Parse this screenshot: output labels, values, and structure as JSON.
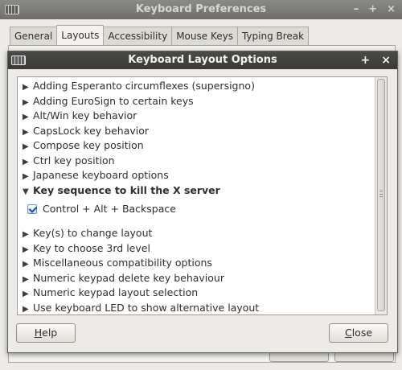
{
  "parent_window": {
    "title": "Keyboard Preferences",
    "controls": {
      "minimize": "–",
      "maximize": "+",
      "close": "×"
    },
    "tabs": [
      {
        "label": "General"
      },
      {
        "label": "Layouts",
        "active": true
      },
      {
        "label": "Accessibility"
      },
      {
        "label": "Mouse Keys"
      },
      {
        "label": "Typing Break"
      }
    ]
  },
  "dialog": {
    "title": "Keyboard Layout Options",
    "controls": {
      "maximize": "+",
      "close": "×"
    },
    "tree": {
      "rows_before": [
        {
          "label": "Adding Esperanto circumflexes (supersigno)",
          "arrow": "▶"
        },
        {
          "label": "Adding EuroSign to certain keys",
          "arrow": "▶"
        },
        {
          "label": "Alt/Win key behavior",
          "arrow": "▶"
        },
        {
          "label": "CapsLock key behavior",
          "arrow": "▶"
        },
        {
          "label": "Compose key position",
          "arrow": "▶"
        },
        {
          "label": "Ctrl key position",
          "arrow": "▶"
        },
        {
          "label": "Japanese keyboard options",
          "arrow": "▶"
        }
      ],
      "expanded_row": {
        "label": "Key sequence to kill the X server",
        "arrow": "▼"
      },
      "child_option": {
        "label": "Control + Alt + Backspace",
        "checked": true
      },
      "rows_after": [
        {
          "label": "Key(s) to change layout",
          "arrow": "▶"
        },
        {
          "label": "Key to choose 3rd level",
          "arrow": "▶"
        },
        {
          "label": "Miscellaneous compatibility options",
          "arrow": "▶"
        },
        {
          "label": "Numeric keypad delete key behaviour",
          "arrow": "▶"
        },
        {
          "label": "Numeric keypad layout selection",
          "arrow": "▶"
        },
        {
          "label": "Use keyboard LED to show alternative layout",
          "arrow": "▶"
        }
      ]
    },
    "buttons": {
      "help": {
        "mnemonic": "H",
        "rest": "elp"
      },
      "close": {
        "mnemonic": "C",
        "rest": "lose"
      }
    }
  }
}
